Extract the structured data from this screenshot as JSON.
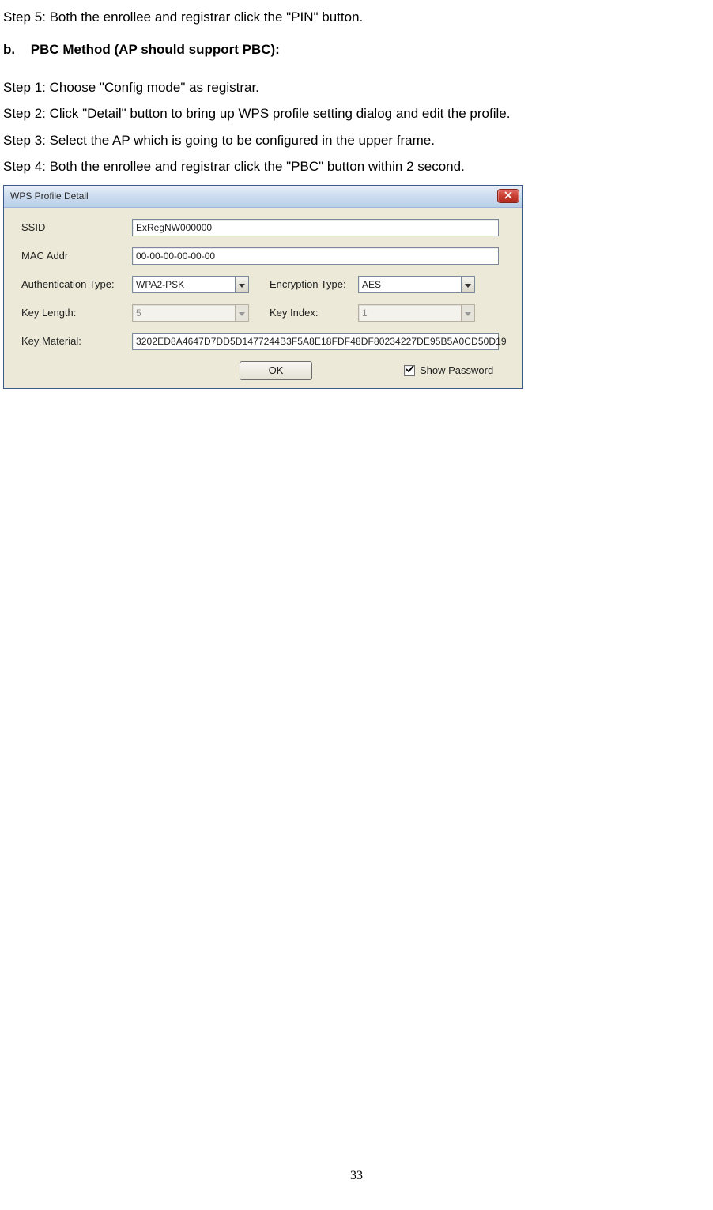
{
  "text": {
    "step5": "Step 5: Both the enrollee and registrar click the \"PIN\" button.",
    "heading_b_letter": "b.",
    "heading_b": "PBC Method (AP should support PBC):",
    "step1": "Step 1: Choose \"Config mode\" as registrar.",
    "step2": "Step 2: Click \"Detail\" button to bring up WPS profile setting dialog and edit the profile.",
    "step3": "Step 3: Select the AP which is going to be configured in the upper frame.",
    "step4": "Step 4: Both the enrollee and registrar click the \"PBC\" button within 2 second.",
    "page_number": "33"
  },
  "dialog": {
    "title": "WPS Profile Detail",
    "labels": {
      "ssid": "SSID",
      "mac": "MAC Addr",
      "auth": "Authentication Type:",
      "enc": "Encryption Type:",
      "keylen": "Key Length:",
      "keyidx": "Key Index:",
      "keymat": "Key Material:",
      "ok": "OK",
      "showpw": "Show Password"
    },
    "values": {
      "ssid": "ExRegNW000000",
      "mac": "00-00-00-00-00-00",
      "auth": "WPA2-PSK",
      "enc": "AES",
      "keylen": "5",
      "keyidx": "1",
      "keymat": "3202ED8A4647D7DD5D1477244B3F5A8E18FDF48DF80234227DE95B5A0CD50D19"
    }
  }
}
